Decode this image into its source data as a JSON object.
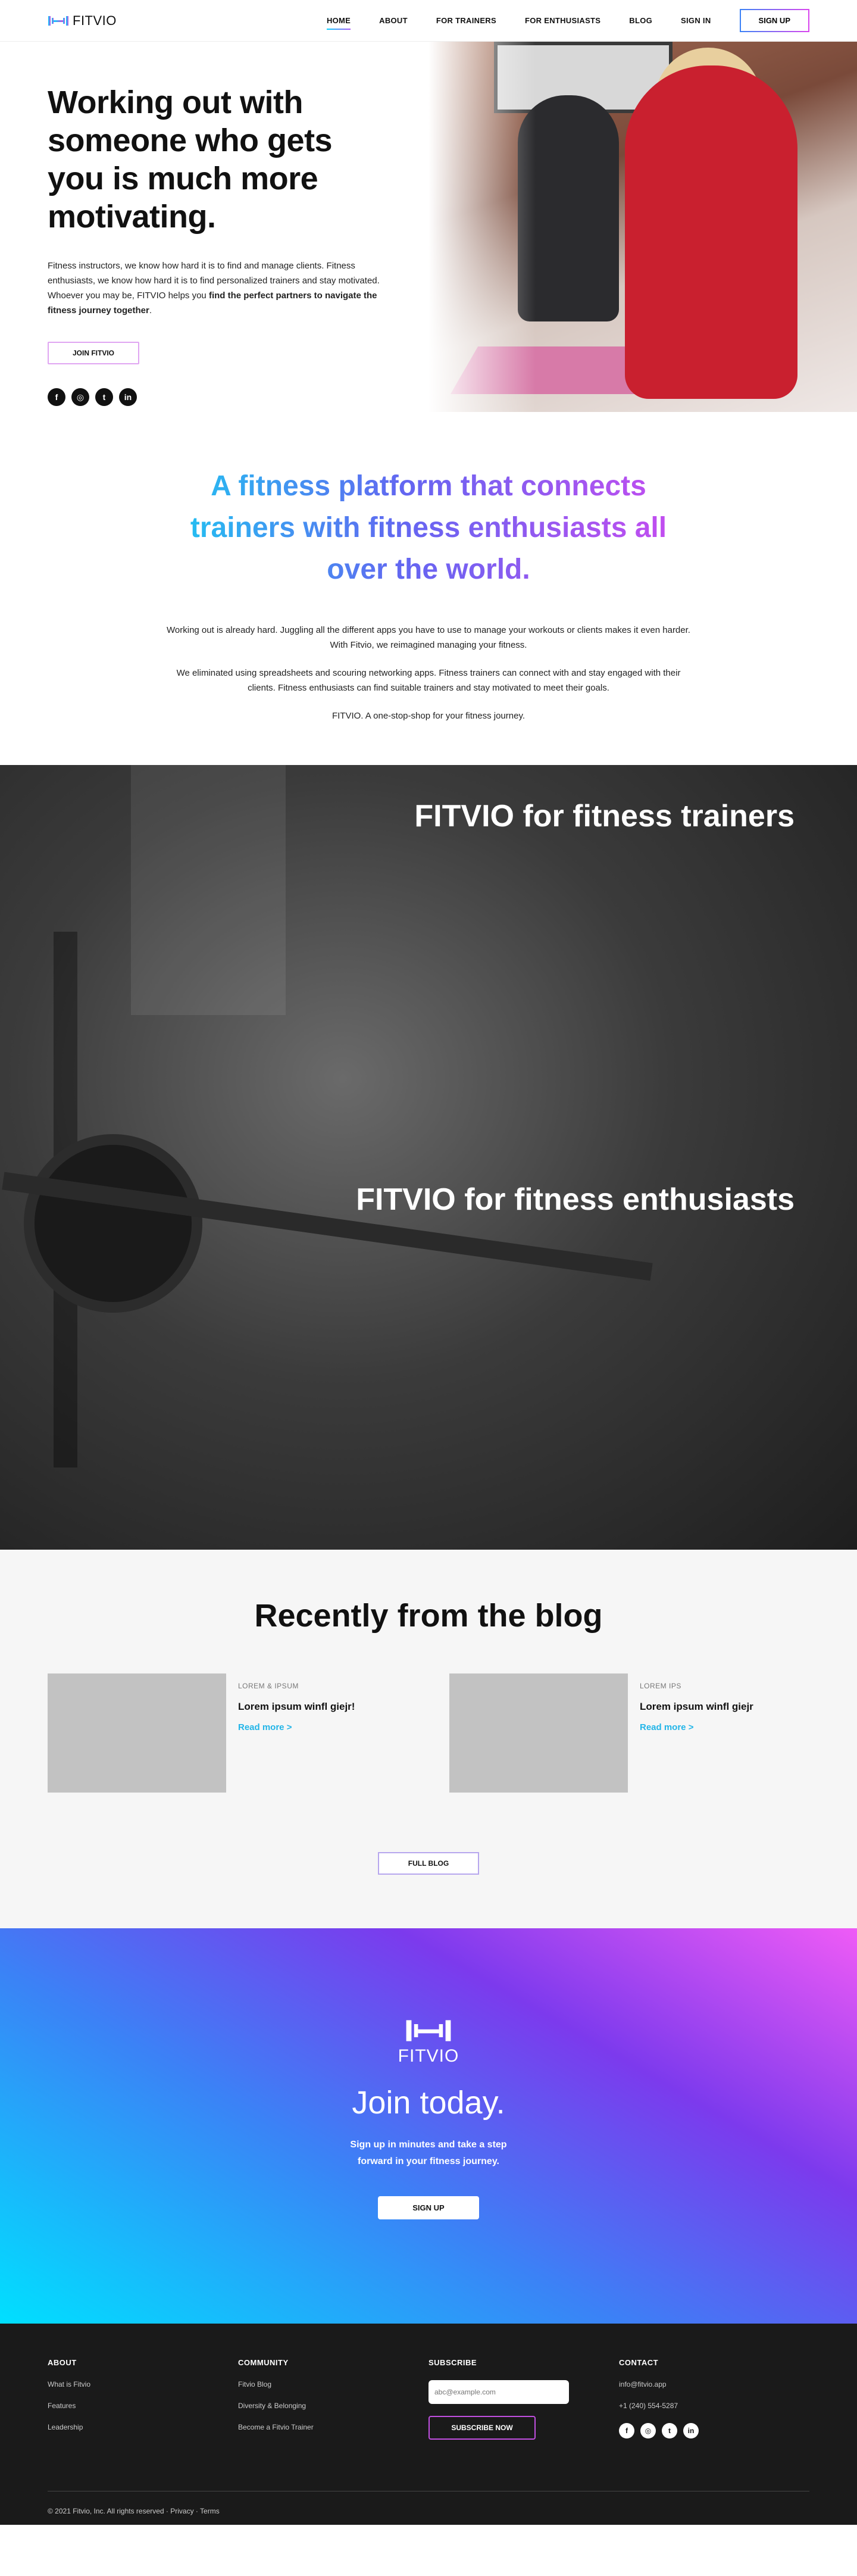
{
  "brand": {
    "name": "FITVIO"
  },
  "nav": {
    "items": [
      {
        "label": "HOME"
      },
      {
        "label": "ABOUT"
      },
      {
        "label": "FOR TRAINERS"
      },
      {
        "label": "FOR ENTHUSIASTS"
      },
      {
        "label": "BLOG"
      },
      {
        "label": "SIGN IN"
      }
    ],
    "signup": "SIGN UP"
  },
  "hero": {
    "title": "Working out with someone who gets you is much more motivating.",
    "text": "Fitness instructors, we know how hard it is to find and manage clients. Fitness enthusiasts, we know how hard it is to find personalized trainers and stay motivated. Whoever you may be, FITVIO helps you ",
    "text_bold": "find the perfect partners to navigate the fitness journey together",
    "text_end": ".",
    "cta": "JOIN FITVIO",
    "socials": [
      "f",
      "◎",
      "t",
      "in"
    ]
  },
  "platform": {
    "title": "A fitness platform that connects trainers with fitness enthusiasts all over the world.",
    "p1": "Working out is already hard. Juggling all the different apps you have to use to manage your workouts or clients makes it even harder. With Fitvio, we reimagined managing your fitness.",
    "p2": "We eliminated using spreadsheets and scouring networking apps. Fitness trainers can connect with and stay engaged with their clients. Fitness enthusiasts can find suitable trainers and stay motivated to meet their goals.",
    "p3": "FITVIO. A one-stop-shop for your fitness journey."
  },
  "dark": {
    "trainers": "FITVIO for fitness trainers",
    "enthusiasts": "FITVIO for fitness enthusiasts"
  },
  "blog": {
    "title": "Recently from the blog",
    "posts": [
      {
        "category": "LOREM & IPSUM",
        "title": "Lorem ipsum winfl giejr!",
        "more": "Read more >"
      },
      {
        "category": "LOREM IPS",
        "title": "Lorem ipsum winfl giejr",
        "more": "Read more >"
      }
    ],
    "full": "FULL BLOG"
  },
  "join": {
    "logo_name": "FITVIO",
    "title": "Join today.",
    "text": "Sign up in minutes and take a step forward in your fitness journey.",
    "cta": "SIGN UP"
  },
  "footer": {
    "about": {
      "title": "ABOUT",
      "links": [
        "What is Fitvio",
        "Features",
        "Leadership"
      ]
    },
    "community": {
      "title": "COMMUNITY",
      "links": [
        "Fitvio Blog",
        "Diversity & Belonging",
        "Become a Fitvio Trainer"
      ]
    },
    "subscribe": {
      "title": "SUBSCRIBE",
      "placeholder": "abc@example.com",
      "button": "SUBSCRIBE NOW"
    },
    "contact": {
      "title": "CONTACT",
      "email": "info@fitvio.app",
      "phone": "+1 (240) 554-5287"
    },
    "copyright": "© 2021 Fitvio, Inc. All rights reserved · Privacy · Terms"
  }
}
